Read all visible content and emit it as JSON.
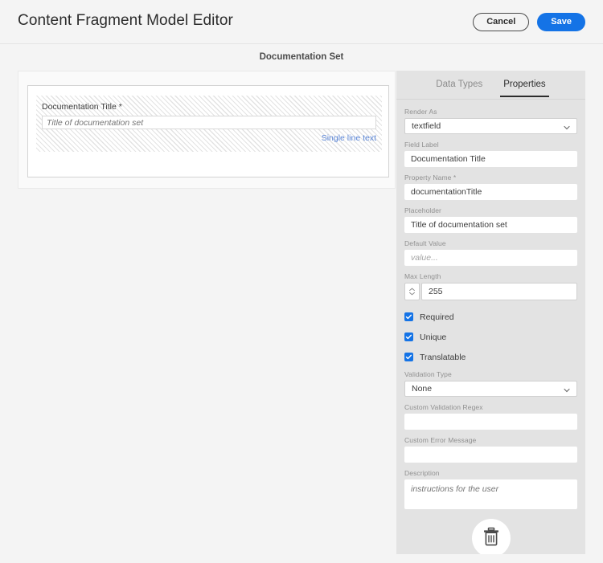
{
  "header": {
    "title": "Content Fragment Model Editor",
    "cancel_label": "Cancel",
    "save_label": "Save",
    "accent_color": "#1473e6"
  },
  "subtitle": "Documentation Set",
  "canvas": {
    "field": {
      "label": "Documentation Title *",
      "input_placeholder": "Title of documentation set",
      "input_value": "",
      "type_link": "Single line text",
      "link_color": "#5c87d8"
    }
  },
  "side_panel": {
    "tabs": [
      {
        "label": "Data Types",
        "active": false
      },
      {
        "label": "Properties",
        "active": true
      }
    ],
    "fields": {
      "render_as": {
        "label": "Render As",
        "value": "textfield"
      },
      "field_label": {
        "label": "Field Label",
        "value": "Documentation Title"
      },
      "property_name": {
        "label": "Property Name *",
        "value": "documentationTitle"
      },
      "placeholder": {
        "label": "Placeholder",
        "value": "Title of documentation set"
      },
      "default_value": {
        "label": "Default Value",
        "value": "",
        "placeholder": "value..."
      },
      "max_length": {
        "label": "Max Length",
        "value": "255"
      },
      "validation_type": {
        "label": "Validation Type",
        "value": "None"
      },
      "custom_validation_regex": {
        "label": "Custom Validation Regex",
        "value": ""
      },
      "custom_error_message": {
        "label": "Custom Error Message",
        "value": ""
      },
      "description": {
        "label": "Description",
        "value": "",
        "placeholder": "instructions for the user"
      }
    },
    "checkboxes": [
      {
        "label": "Required",
        "checked": true
      },
      {
        "label": "Unique",
        "checked": true
      },
      {
        "label": "Translatable",
        "checked": true
      }
    ],
    "delete_icon": "trash-icon"
  }
}
